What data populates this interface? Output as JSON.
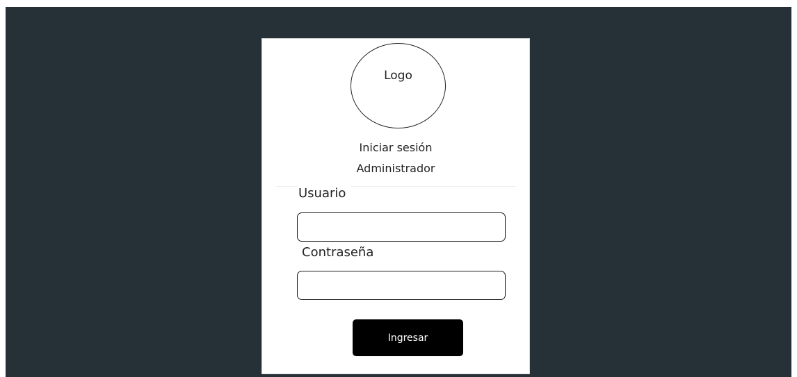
{
  "login": {
    "logo_text": "Logo",
    "title_line1": "Iniciar sesión",
    "title_line2": "Administrador",
    "username_label": "Usuario",
    "username_value": "",
    "password_label": "Contraseña",
    "password_value": "",
    "submit_label": "Ingresar"
  },
  "colors": {
    "page_background": "#263137",
    "card_background": "#ffffff",
    "button_background": "#000000",
    "button_text": "#ffffff"
  }
}
